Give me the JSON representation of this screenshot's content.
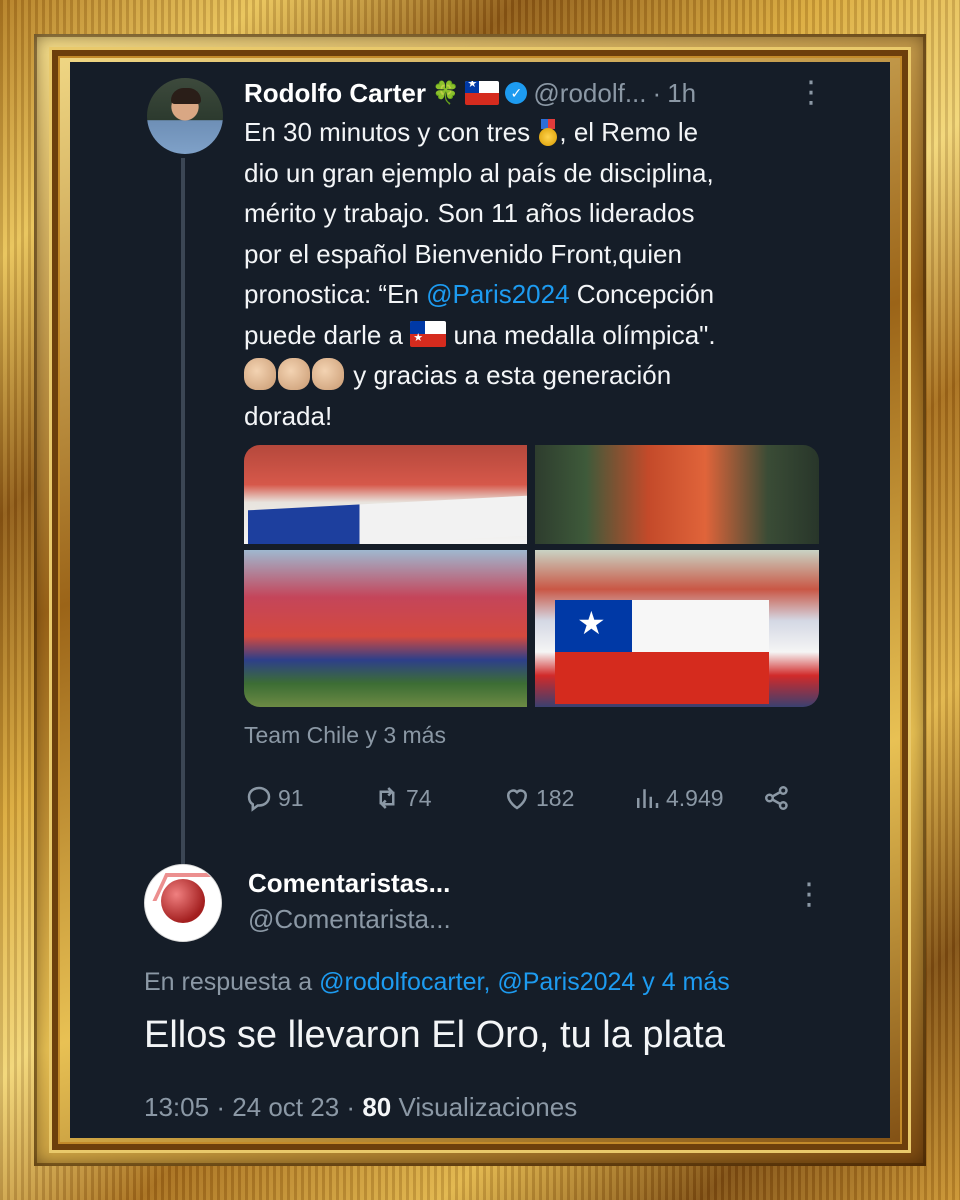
{
  "tweet": {
    "author_name": "Rodolfo Carter",
    "author_emoji": "🍀",
    "author_handle": "@rodolf...",
    "separator": "·",
    "time": "1h",
    "lines": [
      [
        "En 30 minutos y con tres ",
        "medal",
        ", el Remo le"
      ],
      [
        "dio un gran ejemplo al país de disciplina,"
      ],
      [
        "mérito y trabajo. Son 11 años liderados"
      ],
      [
        "por el español Bienvenido Front,quien"
      ],
      [
        "pronostica: “En ",
        "@Paris2024",
        " Concepción"
      ],
      [
        "puede darle a ",
        "flag",
        " una medalla olímpica\"."
      ],
      [
        "clap",
        "clap",
        "clap",
        " y gracias a esta generación"
      ],
      [
        "dorada!"
      ]
    ],
    "media_caption": "Team Chile y 3 más",
    "stats": {
      "replies": "91",
      "retweets": "74",
      "likes": "182",
      "views": "4.949"
    }
  },
  "reply": {
    "author_name": "Comentaristas...",
    "author_handle": "@Comentarista...",
    "in_reply_prefix": "En respuesta a",
    "in_reply_mentions": "@rodolfocarter, @Paris2024 y 4 más",
    "body": "Ellos se llevaron El Oro, tu la plata",
    "time": "13:05",
    "date": "24 oct 23",
    "views_count": "80",
    "views_label": "Visualizaciones"
  },
  "icons": {
    "verified": "verified-badge-icon",
    "reply": "reply-icon",
    "retweet": "retweet-icon",
    "like": "heart-icon",
    "views": "views-icon",
    "share": "share-icon",
    "more": "more-vertical-icon"
  },
  "colors": {
    "background": "#151d28",
    "link": "#1d9bf0",
    "muted": "#8b98a5",
    "text": "#f3f5f7",
    "frame_gold": "#d9a93c"
  }
}
